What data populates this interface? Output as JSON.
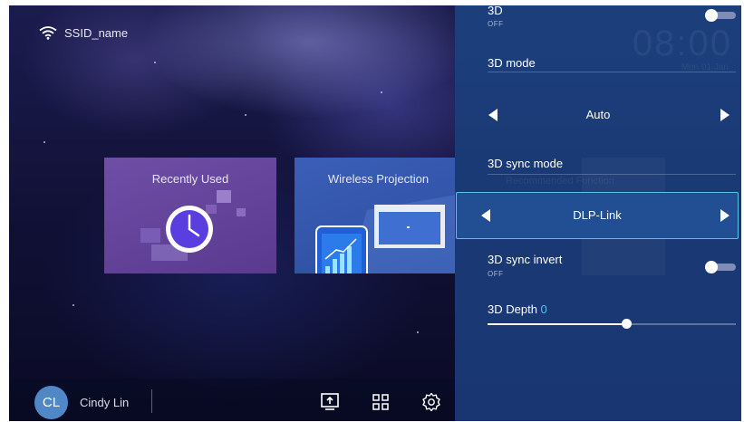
{
  "status": {
    "ssid": "SSID_name",
    "wifi_icon": "wifi-icon"
  },
  "tiles": [
    {
      "label": "Recently Used",
      "icon": "clock-icon"
    },
    {
      "label": "Wireless Projection",
      "icon": "phone-screen-icon"
    }
  ],
  "bottom_bar": {
    "avatar_initials": "CL",
    "user_name": "Cindy Lin",
    "icons": [
      "input-source-icon",
      "apps-grid-icon",
      "settings-gear-icon"
    ]
  },
  "panel": {
    "clock": "08:00",
    "date": "Mon 01 Jan",
    "ghost_text": "Recommended Function",
    "items": [
      {
        "title": "3D",
        "sub": "OFF",
        "type": "toggle",
        "value": "off"
      },
      {
        "title": "3D mode",
        "type": "selector",
        "value": "Auto"
      },
      {
        "title": "3D sync mode",
        "type": "selector",
        "value": "DLP-Link",
        "focused": true
      },
      {
        "title": "3D sync invert",
        "sub": "OFF",
        "type": "toggle",
        "value": "off"
      },
      {
        "title": "3D Depth",
        "type": "slider",
        "value": "0",
        "level_fraction": 0.56
      }
    ]
  },
  "colors": {
    "panel_bg": "#1c3f7c",
    "focus_border": "#56c6df",
    "accent_value": "#4fc3f0",
    "avatar_bg": "#4f87c7",
    "recent_tile": "#6f4fa6",
    "wireless_tile": "#3b5fb8"
  }
}
